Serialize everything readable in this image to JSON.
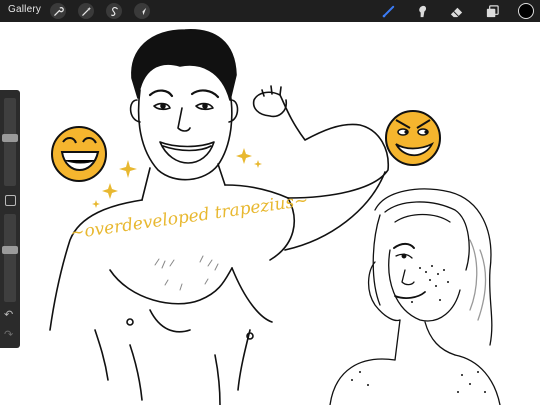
{
  "toolbar": {
    "gallery_label": "Gallery",
    "left_tools": [
      "wrench-icon",
      "magic-wand-icon",
      "selection-icon",
      "transform-icon"
    ],
    "right_tools": [
      "brush-icon",
      "smudge-icon",
      "eraser-icon",
      "layers-icon"
    ],
    "active_tool": "brush-icon",
    "brush_accent": "#3b7cf6",
    "current_color": "#000000"
  },
  "sidebar": {
    "brush_size_level": 0.55,
    "opacity_level": 0.6,
    "undo_icon": "undo-icon",
    "redo_icon": "redo-icon"
  },
  "canvas": {
    "caption_text": "~overdeveloped trapezius~",
    "caption_color": "#e8b830",
    "emoji_face_color": "#f5b52e"
  }
}
